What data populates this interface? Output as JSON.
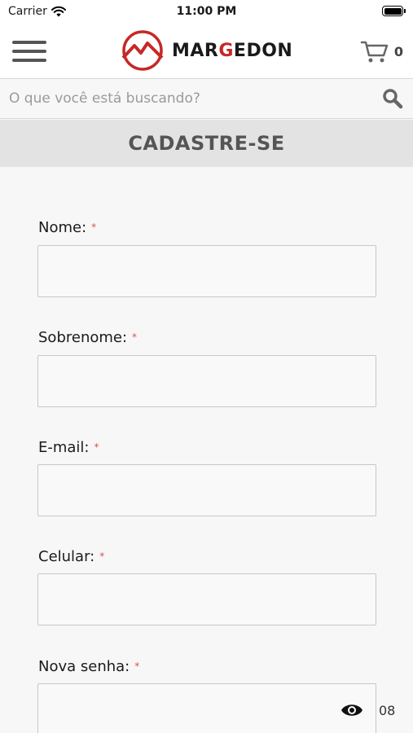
{
  "status_bar": {
    "carrier": "Carrier",
    "time": "11:00 PM"
  },
  "header": {
    "logo_text_pre": "MAR",
    "logo_text_accent": "G",
    "logo_text_post": "EDON",
    "cart_count": "0",
    "brand_color": "#c62828"
  },
  "search": {
    "placeholder": "O que você está buscando?",
    "value": ""
  },
  "page": {
    "title": "CADASTRE-SE"
  },
  "form": {
    "required_marker": "*",
    "fields": [
      {
        "label": "Nome:",
        "value": ""
      },
      {
        "label": "Sobrenome:",
        "value": ""
      },
      {
        "label": "E-mail:",
        "value": ""
      },
      {
        "label": "Celular:",
        "value": ""
      },
      {
        "label": "Nova senha:",
        "value": ""
      }
    ],
    "password_side_text": "08"
  },
  "icons": [
    "wifi-icon",
    "battery-icon",
    "menu-icon",
    "logo-mountain-icon",
    "cart-icon",
    "search-icon",
    "eye-icon"
  ]
}
